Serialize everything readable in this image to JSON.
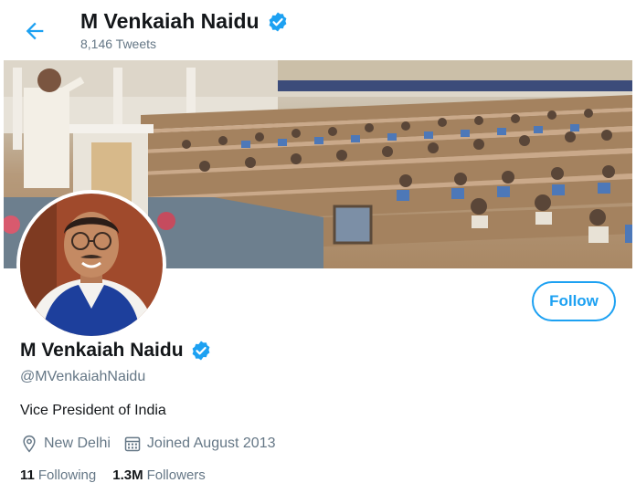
{
  "header": {
    "back_icon": "arrow-left-icon",
    "name": "M Venkaiah Naidu",
    "tweet_count": "8,146 Tweets",
    "verified_icon": "verified-badge-icon"
  },
  "profile": {
    "name": "M Venkaiah Naidu",
    "handle": "@MVenkaiahNaidu",
    "bio": "Vice President of India",
    "location": "New Delhi",
    "location_icon": "location-pin-icon",
    "joined": "Joined August 2013",
    "joined_icon": "calendar-icon",
    "follow_label": "Follow"
  },
  "stats": {
    "following_count": "11",
    "following_label": "Following",
    "followers_count": "1.3M",
    "followers_label": "Followers"
  },
  "colors": {
    "accent": "#1da1f2",
    "muted": "#657786",
    "text": "#14171a"
  }
}
